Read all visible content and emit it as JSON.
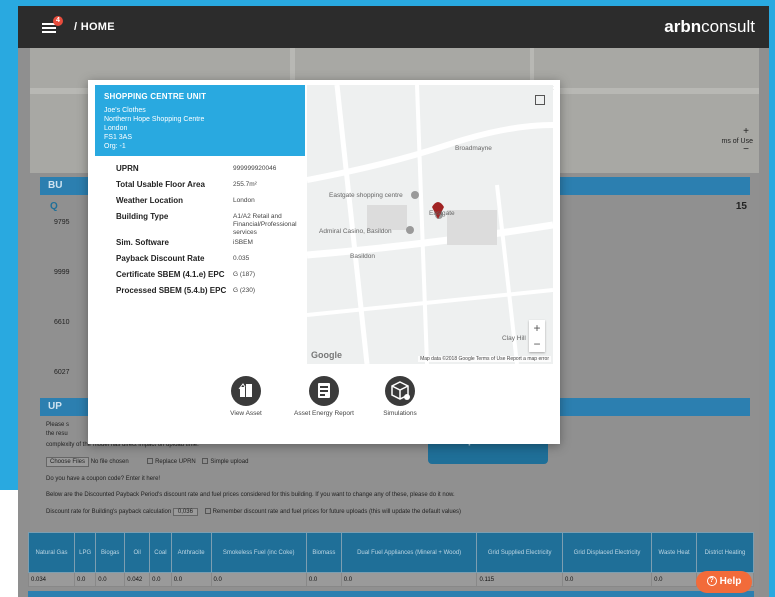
{
  "topbar": {
    "menu_badge": "4",
    "breadcrumb": "/ HOME",
    "logo_bold": "arbn",
    "logo_rest": "consult"
  },
  "modal": {
    "close": "×",
    "header": {
      "title": "SHOPPING CENTRE UNIT",
      "lines": [
        "Joe's Clothes",
        "Northern Hope Shopping Centre",
        "London",
        "FS1 3AS",
        "Org: -1"
      ]
    },
    "details": [
      {
        "key": "UPRN",
        "value": "999999920046"
      },
      {
        "key": "Total Usable Floor Area",
        "value": "255.7m²"
      },
      {
        "key": "Weather Location",
        "value": "London"
      },
      {
        "key": "Building Type",
        "value": "A1/A2 Retail and Financial/Professional services"
      },
      {
        "key": "Sim. Software",
        "value": "iSBEM"
      },
      {
        "key": "Payback Discount Rate",
        "value": "0.035"
      },
      {
        "key": "Certificate SBEM (4.1.e) EPC",
        "value": "G (187)"
      },
      {
        "key": "Processed SBEM (5.4.b) EPC",
        "value": "G (230)"
      }
    ],
    "map": {
      "labels": [
        "Eastgate shopping centre",
        "Admiral Casino, Basildon",
        "Basildon",
        "Eastgate",
        "Broadmayne",
        "Clay Hill"
      ],
      "footer": "Map data ©2018 Google  Terms of Use  Report a map error",
      "google": "Google",
      "zoom_in": "+",
      "zoom_out": "−"
    },
    "actions": [
      {
        "label": "View Asset",
        "icon": "building-icon"
      },
      {
        "label": "Asset Energy Report",
        "icon": "report-icon"
      },
      {
        "label": "Simulations",
        "icon": "simulation-cube-icon"
      }
    ]
  },
  "background": {
    "bar1": "BU",
    "search_q": "Q",
    "rows": [
      "9795",
      "9999",
      "6610",
      "6027"
    ],
    "right_num": "15",
    "bar2": "UP",
    "upload_button": "Upload file",
    "text1": "Please s",
    "text2": "the resu",
    "text3": "complexity of the model has direct impact on upload time.",
    "choose_files": "Choose Files",
    "no_file": "No file chosen",
    "replace_uprn": "Replace UPRN",
    "simple_upload": "Simple upload",
    "coupon": "Do you have a coupon code? Enter it here!",
    "discount_note": "Below are the Discounted Payback Period's discount rate and fuel prices considered for this building. If you want to change any of these, please do it now.",
    "discount_label": "Discount rate for Building's payback calculation",
    "discount_value": "0,036",
    "remember": "Remember discount rate and fuel prices for future uploads (this will update the default values)",
    "zoom_plus": "+",
    "zoom_minus": "−",
    "terms": "ms of Use"
  },
  "fuel_table": {
    "headers": [
      "Natural Gas",
      "LPG",
      "Biogas",
      "Oil",
      "Coal",
      "Anthracite",
      "Smokeless Fuel (inc Coke)",
      "Biomass",
      "Dual Fuel Appliances (Mineral + Wood)",
      "Grid Supplied Electricity",
      "Grid Displaced Electricity",
      "Waste Heat",
      "District Heating"
    ],
    "values": [
      "0.034",
      "0.0",
      "0.0",
      "0.042",
      "0.0",
      "0.0",
      "0.0",
      "0.0",
      "0.0",
      "0.115",
      "0.0",
      "0.0",
      "0.0"
    ]
  },
  "help": {
    "label": "Help",
    "q": "?"
  }
}
